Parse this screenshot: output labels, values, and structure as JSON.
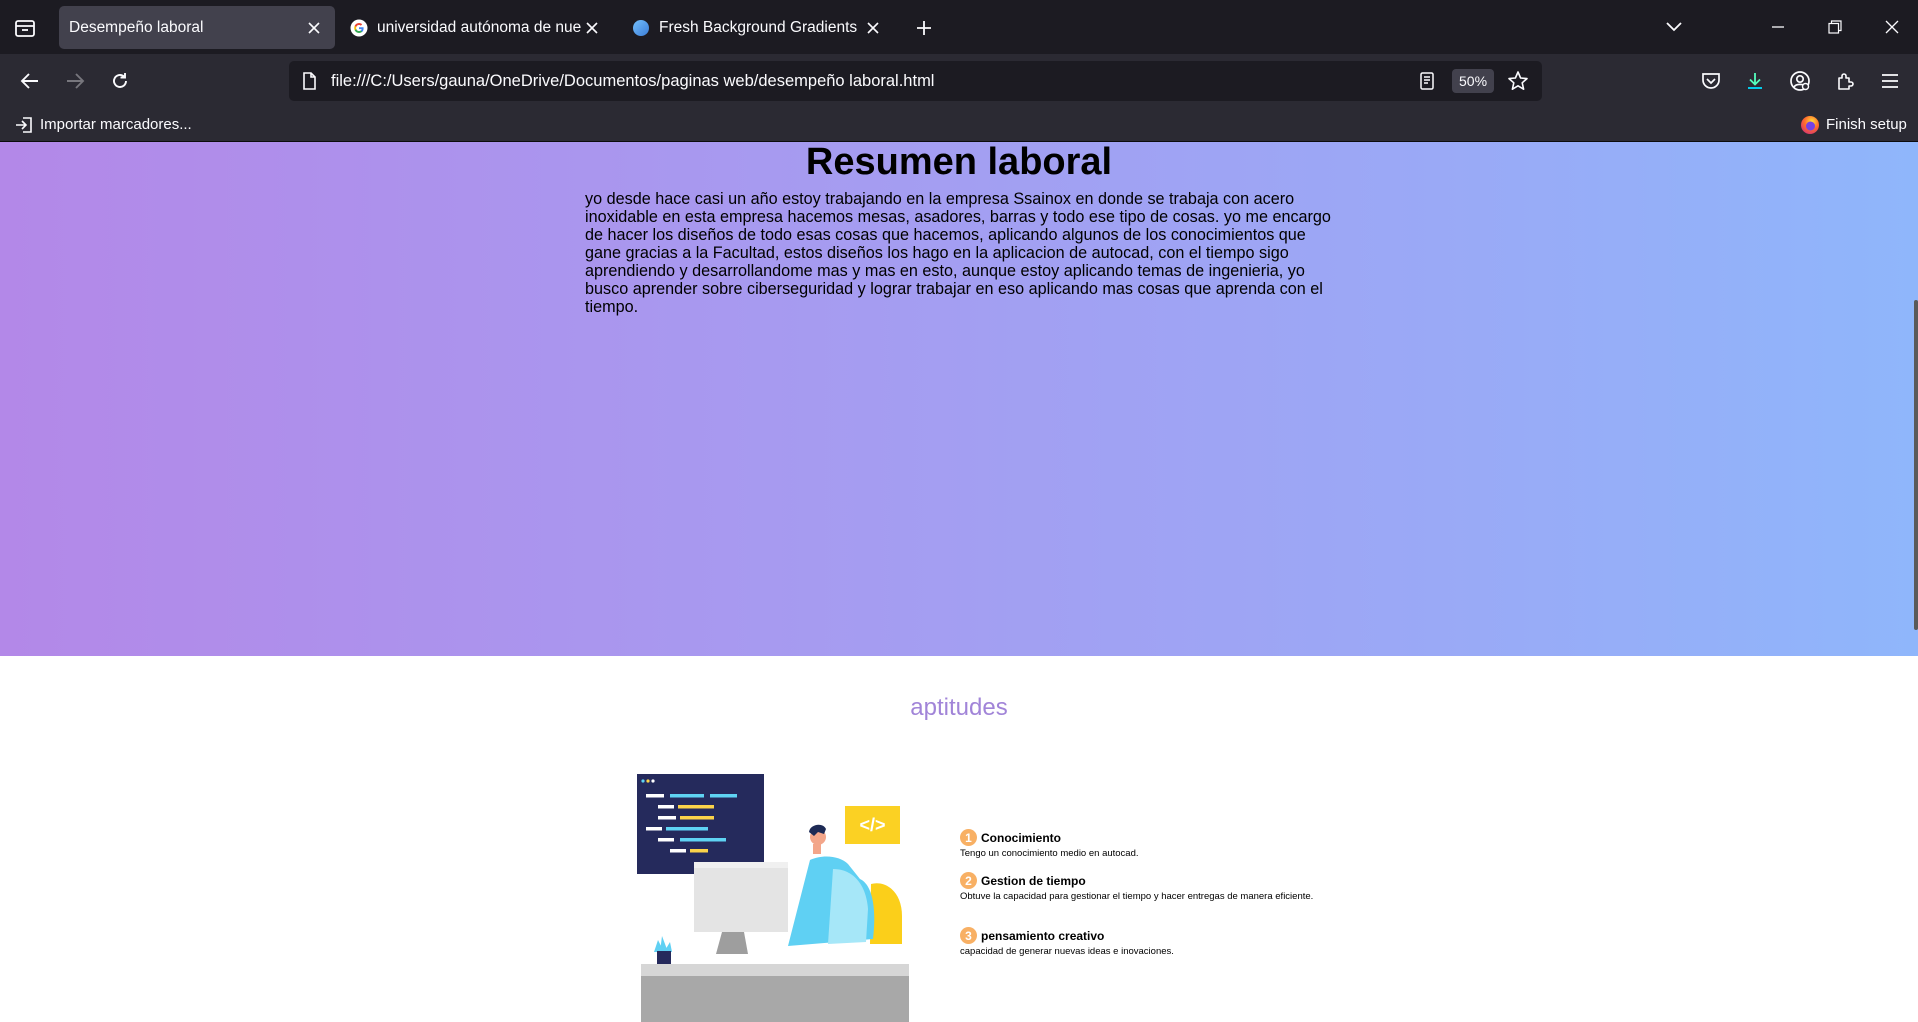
{
  "tabs": [
    {
      "title": "Desempeño laboral",
      "active": true,
      "favicon": "page-icon"
    },
    {
      "title": "universidad autónoma de nuevo",
      "active": false,
      "favicon": "google-icon"
    },
    {
      "title": "Fresh Background Gradients | W",
      "active": false,
      "favicon": "webgradients-icon"
    }
  ],
  "navbar": {
    "url": "file:///C:/Users/gauna/OneDrive/Documentos/paginas web/desempeño laboral.html",
    "zoom": "50%"
  },
  "bookmarks": {
    "import_label": "Importar marcadores...",
    "finish_setup_label": "Finish setup"
  },
  "page": {
    "title": "Resumen laboral",
    "summary": "yo desde hace casi un año estoy trabajando en la empresa Ssainox en donde se trabaja con acero inoxidable en esta empresa hacemos mesas, asadores, barras y todo ese tipo de cosas. yo me encargo de hacer los diseños de todo esas cosas que hacemos, aplicando algunos de los conocimientos que gane gracias a la Facultad, estos diseños los hago en la aplicacion de autocad, con el tiempo sigo aprendiendo y desarrollandome mas y mas en esto, aunque estoy aplicando temas de ingenieria, yo busco aprender sobre ciberseguridad y lograr trabajar en eso aplicando mas cosas que aprenda con el tiempo.",
    "skills_title": "aptitudes",
    "skills": [
      {
        "num": "1",
        "name": "Conocimiento",
        "desc": "Tengo un conocimiento medio en autocad."
      },
      {
        "num": "2",
        "name": "Gestion de tiempo",
        "desc": "Obtuve la capacidad para gestionar el tiempo y hacer entregas de manera eficiente."
      },
      {
        "num": "3",
        "name": "pensamiento creativo",
        "desc": "capacidad de generar nuevas ideas e inovaciones."
      }
    ],
    "illustration_code_label": "</>"
  },
  "colors": {
    "gradient_start": "#b388e8",
    "gradient_end": "#8fb6fb",
    "skills_title": "#a184d8",
    "skill_badge": "#f8b064"
  }
}
